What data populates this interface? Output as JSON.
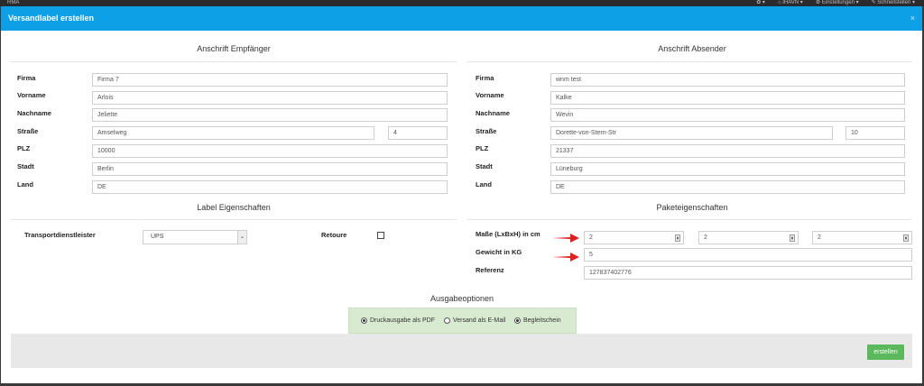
{
  "topbar": {
    "brand": "RMA",
    "items": [
      "✿ ▾",
      "⌂ IHAVN ▾",
      "⚙ Einstellungen ▾",
      "✎ Schnellstellen ▾"
    ]
  },
  "modal": {
    "title": "Versandlabel erstellen",
    "close": "×"
  },
  "recipient": {
    "heading": "Anschrift Empfänger",
    "labels": {
      "firma": "Firma",
      "vorname": "Vorname",
      "nachname": "Nachname",
      "strasse": "Straße",
      "plz": "PLZ",
      "stadt": "Stadt",
      "land": "Land"
    },
    "values": {
      "firma": "Firma 7",
      "vorname": "Arlois",
      "nachname": "Jeliette",
      "strasse": "Amselweg",
      "hausnr": "4",
      "plz": "10000",
      "stadt": "Berlin",
      "land": "DE"
    }
  },
  "sender": {
    "heading": "Anschrift Absender",
    "labels": {
      "firma": "Firma",
      "vorname": "Vorname",
      "nachname": "Nachname",
      "strasse": "Straße",
      "plz": "PLZ",
      "stadt": "Stadt",
      "land": "Land"
    },
    "values": {
      "firma": "wnm test",
      "vorname": "Kalke",
      "nachname": "Wevin",
      "strasse": "Dorette-von-Stern-Str",
      "hausnr": "10",
      "plz": "21337",
      "stadt": "Lüneburg",
      "land": "DE"
    }
  },
  "label_props": {
    "heading": "Label Eigenschaften",
    "carrier_label": "Transportdienstleister",
    "carrier_value": "UPS",
    "return_label": "Retoure",
    "return_checked": false
  },
  "package_props": {
    "heading": "Paketeigenschaften",
    "dims_label": "Maße (LxBxH) in cm",
    "dims": [
      "2",
      "2",
      "2"
    ],
    "weight_label": "Gewicht in KG",
    "weight": "5",
    "ref_label": "Referenz",
    "ref": "127837402776"
  },
  "output": {
    "heading": "Ausgabeoptionen",
    "options": [
      {
        "label": "Druckausgabe als PDF",
        "checked": true
      },
      {
        "label": "Versand als E-Mail",
        "checked": false
      },
      {
        "label": "Begleitschein",
        "checked": true
      }
    ]
  },
  "create_button": "erstellen",
  "colors": {
    "header": "#0ea0e6",
    "button": "#5cb85c",
    "output_bg": "#d8ebd1",
    "arrow": "#e02020"
  }
}
